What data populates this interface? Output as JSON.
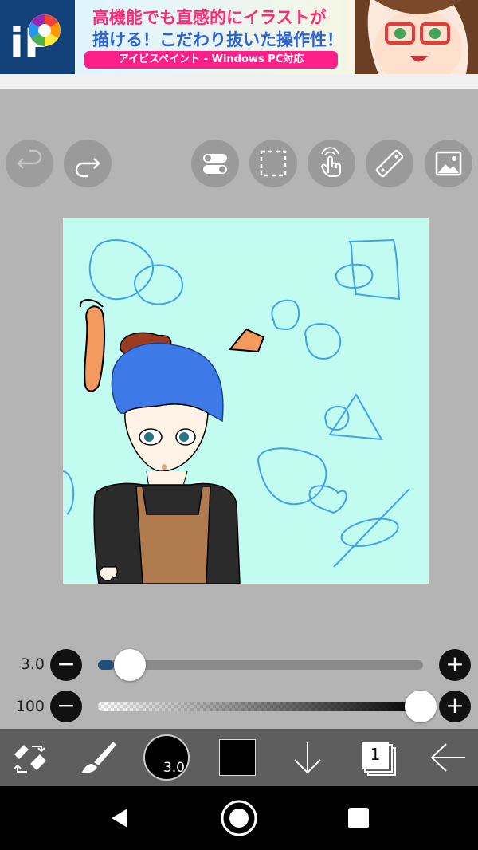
{
  "ad": {
    "line1": "高機能でも直感的にイラストが",
    "line2": "描ける！こだわり抜いた操作性！",
    "line3": "アイビスペイント - Windows PC対応",
    "logo_text": "iP"
  },
  "toolbar": {
    "buttons": [
      "undo-icon",
      "redo-icon",
      "toggle-icon",
      "selection-icon",
      "touch-icon",
      "ruler-icon",
      "image-icon"
    ]
  },
  "brush": {
    "size_label": "3.0",
    "size_value": 3.0,
    "opacity_label": "100",
    "opacity_value": 100,
    "minus": "−",
    "plus": "+"
  },
  "bottom": {
    "brush_size_display": "3.0",
    "layer_count": "1",
    "color": "#000000"
  },
  "colors": {
    "canvas_bg": "#c2fbf0",
    "slider_fill": "#1f4e79",
    "stroke": "#3fa3ea"
  }
}
